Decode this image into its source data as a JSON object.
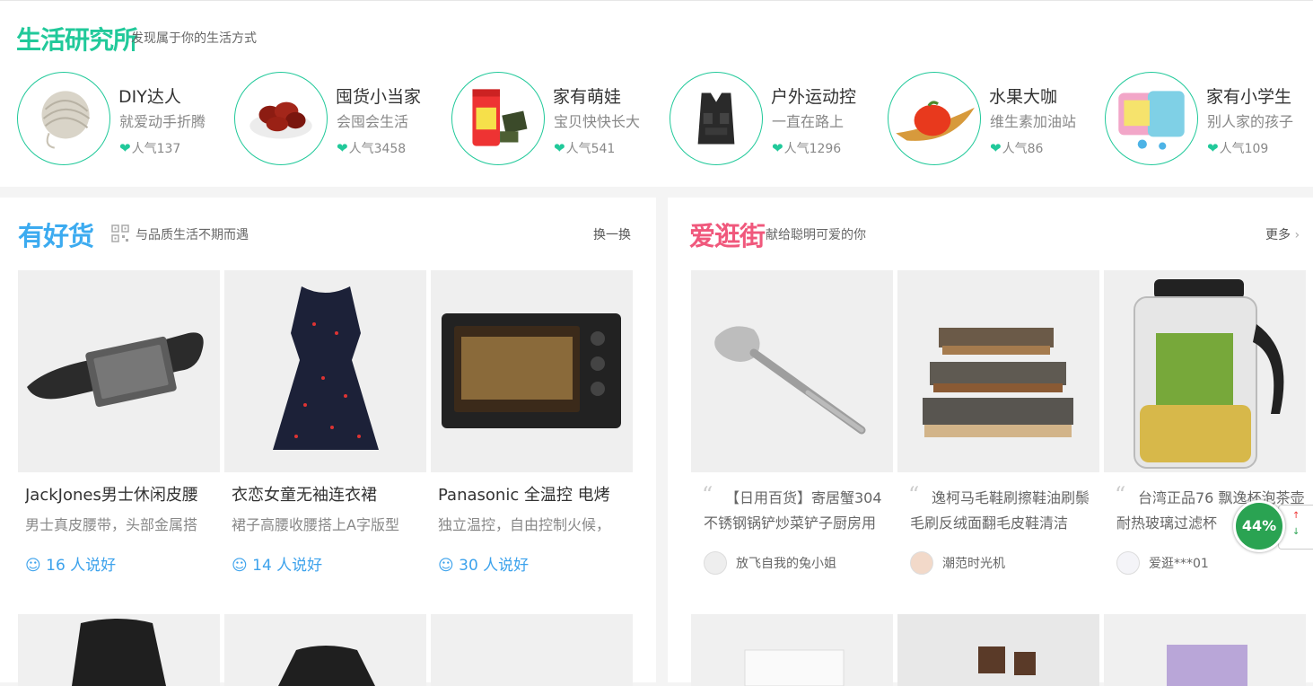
{
  "lab": {
    "logo": "生活研究所",
    "subtitle": "发现属于你的生活方式",
    "items": [
      {
        "title": "DIY达人",
        "desc": "就爱动手折腾",
        "pop": "人气137"
      },
      {
        "title": "囤货小当家",
        "desc": "会囤会生活",
        "pop": "人气3458"
      },
      {
        "title": "家有萌娃",
        "desc": "宝贝快快长大",
        "pop": "人气541"
      },
      {
        "title": "户外运动控",
        "desc": "一直在路上",
        "pop": "人气1296"
      },
      {
        "title": "水果大咖",
        "desc": "维生素加油站",
        "pop": "人气86"
      },
      {
        "title": "家有小学生",
        "desc": "别人家的孩子",
        "pop": "人气109"
      }
    ]
  },
  "goodgoods": {
    "title": "有好货",
    "subtitle": "与品质生活不期而遇",
    "switch": "换一换",
    "cards": [
      {
        "title": "JackJones男士休闲皮腰",
        "desc": "男士真皮腰带，头部金属搭",
        "likes": "16 人说好"
      },
      {
        "title": "衣恋女童无袖连衣裙",
        "desc": "裙子高腰收腰搭上A字版型",
        "likes": "14 人说好"
      },
      {
        "title": "Panasonic 全温控 电烤",
        "desc": "独立温控，自由控制火候，",
        "likes": "30 人说好"
      }
    ]
  },
  "loveshop": {
    "title": "爱逛街",
    "subtitle": "献给聪明可爱的你",
    "more": "更多",
    "cards": [
      {
        "text": "【日用百货】寄居蟹304不锈钢锅铲炒菜铲子厨房用",
        "user": "放飞自我的兔小姐"
      },
      {
        "text": "逸柯马毛鞋刷擦鞋油刷鬃毛刷反绒面翻毛皮鞋清洁",
        "user": "潮范时光机"
      },
      {
        "text": "台湾正品76 飘逸杯泡茶壶耐热玻璃过滤杯",
        "user": "爱逛***01"
      }
    ]
  },
  "widget": {
    "percent": "44%"
  },
  "colors": {
    "lab_green": "#21c99a",
    "good_blue": "#3cabf0",
    "love_pink": "#f0587c",
    "like_blue": "#3ca2ec"
  }
}
